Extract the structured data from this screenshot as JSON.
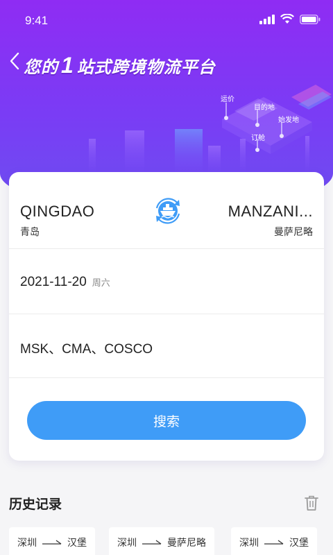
{
  "status_bar": {
    "time": "9:41"
  },
  "header": {
    "slogan_prefix": "您的",
    "slogan_number": "1",
    "slogan_suffix": "站式跨境物流平台",
    "illustration_labels": [
      "运价",
      "目的地",
      "始发地",
      "订舱"
    ]
  },
  "search": {
    "origin": {
      "code": "QINGDAO",
      "name_cn": "青岛"
    },
    "destination": {
      "code": "MANZANI...",
      "name_cn": "曼萨尼略"
    },
    "date": "2021-11-20",
    "weekday": "周六",
    "carriers": "MSK、CMA、COSCO",
    "button_label": "搜索"
  },
  "history": {
    "title": "历史记录",
    "items": [
      {
        "from": "深圳",
        "to": "汉堡"
      },
      {
        "from": "深圳",
        "to": "曼萨尼略"
      },
      {
        "from": "深圳",
        "to": "汉堡"
      }
    ]
  },
  "colors": {
    "hero_top": "#8f2cf3",
    "hero_bottom": "#6c4ff0",
    "accent_blue": "#3f9cf7",
    "text_dark": "#222222"
  },
  "icons": [
    "back-arrow-icon",
    "ship-swap-icon",
    "trash-icon",
    "signal-icon",
    "wifi-icon",
    "battery-icon",
    "route-arrow-icon"
  ]
}
